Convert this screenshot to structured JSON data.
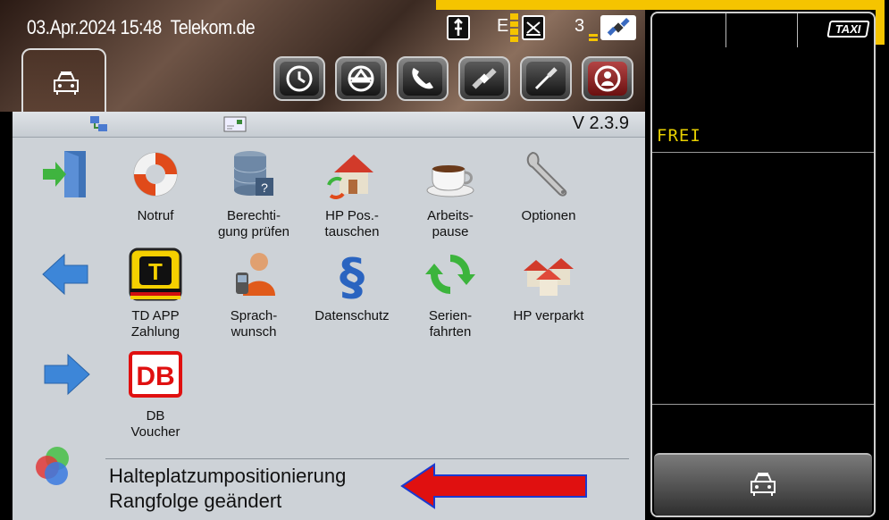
{
  "status_bar": {
    "datetime": "03.Apr.2024 15:48",
    "network": "Telekom.de",
    "e_label": "E",
    "count_label": "3"
  },
  "header": {
    "version": "V 2.3.9"
  },
  "grid": [
    {
      "name": "exit",
      "label": ""
    },
    {
      "name": "notruf",
      "label": "Notruf"
    },
    {
      "name": "berechtigung",
      "label": "Berechti-\ngung prüfen"
    },
    {
      "name": "hp-pos",
      "label": "HP Pos.-\ntauschen"
    },
    {
      "name": "arbeitspause",
      "label": "Arbeits-\npause"
    },
    {
      "name": "optionen",
      "label": "Optionen"
    },
    {
      "name": "back",
      "label": ""
    },
    {
      "name": "td-app",
      "label": "TD APP\nZahlung"
    },
    {
      "name": "sprachwunsch",
      "label": "Sprach-\nwunsch"
    },
    {
      "name": "datenschutz",
      "label": "Datenschutz"
    },
    {
      "name": "serienfahrten",
      "label": "Serien-\nfahrten"
    },
    {
      "name": "hp-verparkt",
      "label": "HP verparkt"
    },
    {
      "name": "forward",
      "label": ""
    },
    {
      "name": "db-voucher",
      "label": "DB\nVoucher"
    }
  ],
  "message": {
    "line1": "Halteplatzumpositionierung",
    "line2": "Rangfolge geändert"
  },
  "taximeter": {
    "badge": "TAXI",
    "status": "FREI"
  },
  "icons": {
    "db_logo": "DB",
    "td_logo": "T"
  },
  "colors": {
    "accent": "#f5c400",
    "status": "#e8d000",
    "arrow": "#e01010"
  }
}
